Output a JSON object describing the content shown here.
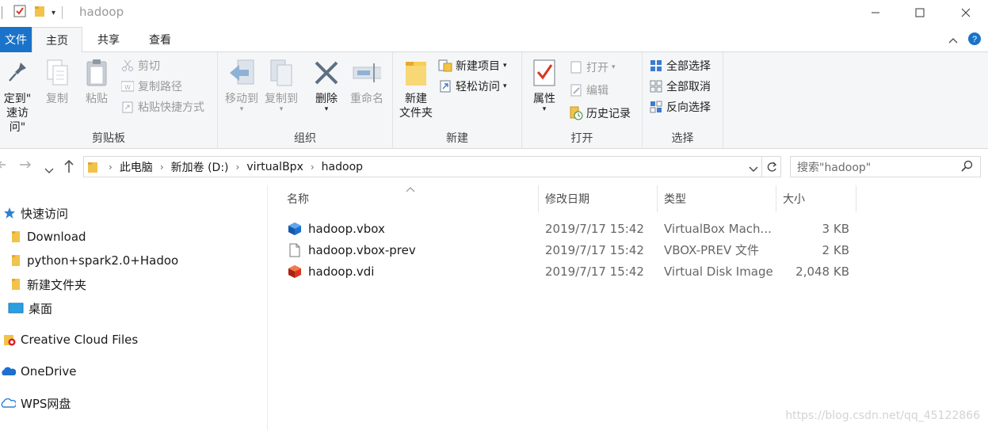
{
  "window": {
    "title": "hadoop"
  },
  "tabs": {
    "file": "文件",
    "home": "主页",
    "share": "共享",
    "view": "查看"
  },
  "ribbon": {
    "clipboard": {
      "label": "剪贴板",
      "pin_line1": "定到\"",
      "pin_line2": "速访问\"",
      "copy": "复制",
      "paste": "粘贴",
      "cut": "剪切",
      "copy_path": "复制路径",
      "paste_shortcut": "粘贴快捷方式"
    },
    "organize": {
      "label": "组织",
      "move_to": "移动到",
      "copy_to": "复制到",
      "delete": "删除",
      "rename": "重命名"
    },
    "new": {
      "label": "新建",
      "new_folder_line1": "新建",
      "new_folder_line2": "文件夹",
      "new_item": "新建项目",
      "easy_access": "轻松访问"
    },
    "open": {
      "label": "打开",
      "properties": "属性",
      "open": "打开",
      "edit": "编辑",
      "history": "历史记录"
    },
    "select": {
      "label": "选择",
      "select_all": "全部选择",
      "select_none": "全部取消",
      "invert": "反向选择"
    }
  },
  "address": {
    "crumbs": [
      "此电脑",
      "新加卷 (D:)",
      "virtualBpx",
      "hadoop"
    ],
    "search_placeholder": "搜索\"hadoop\""
  },
  "sidebar": {
    "items": [
      {
        "label": "快速访问"
      },
      {
        "label": "Download"
      },
      {
        "label": "python+spark2.0+Hadoo"
      },
      {
        "label": "新建文件夹"
      },
      {
        "label": "桌面"
      },
      {
        "label": "Creative Cloud Files"
      },
      {
        "label": "OneDrive"
      },
      {
        "label": "WPS网盘"
      }
    ]
  },
  "files": {
    "columns": {
      "name": "名称",
      "modified": "修改日期",
      "type": "类型",
      "size": "大小"
    },
    "rows": [
      {
        "name": "hadoop.vbox",
        "modified": "2019/7/17 15:42",
        "type": "VirtualBox Mach...",
        "size": "3 KB"
      },
      {
        "name": "hadoop.vbox-prev",
        "modified": "2019/7/17 15:42",
        "type": "VBOX-PREV 文件",
        "size": "2 KB"
      },
      {
        "name": "hadoop.vdi",
        "modified": "2019/7/17 15:42",
        "type": "Virtual Disk Image",
        "size": "2,048 KB"
      }
    ]
  },
  "watermark": "https://blog.csdn.net/qq_45122866"
}
